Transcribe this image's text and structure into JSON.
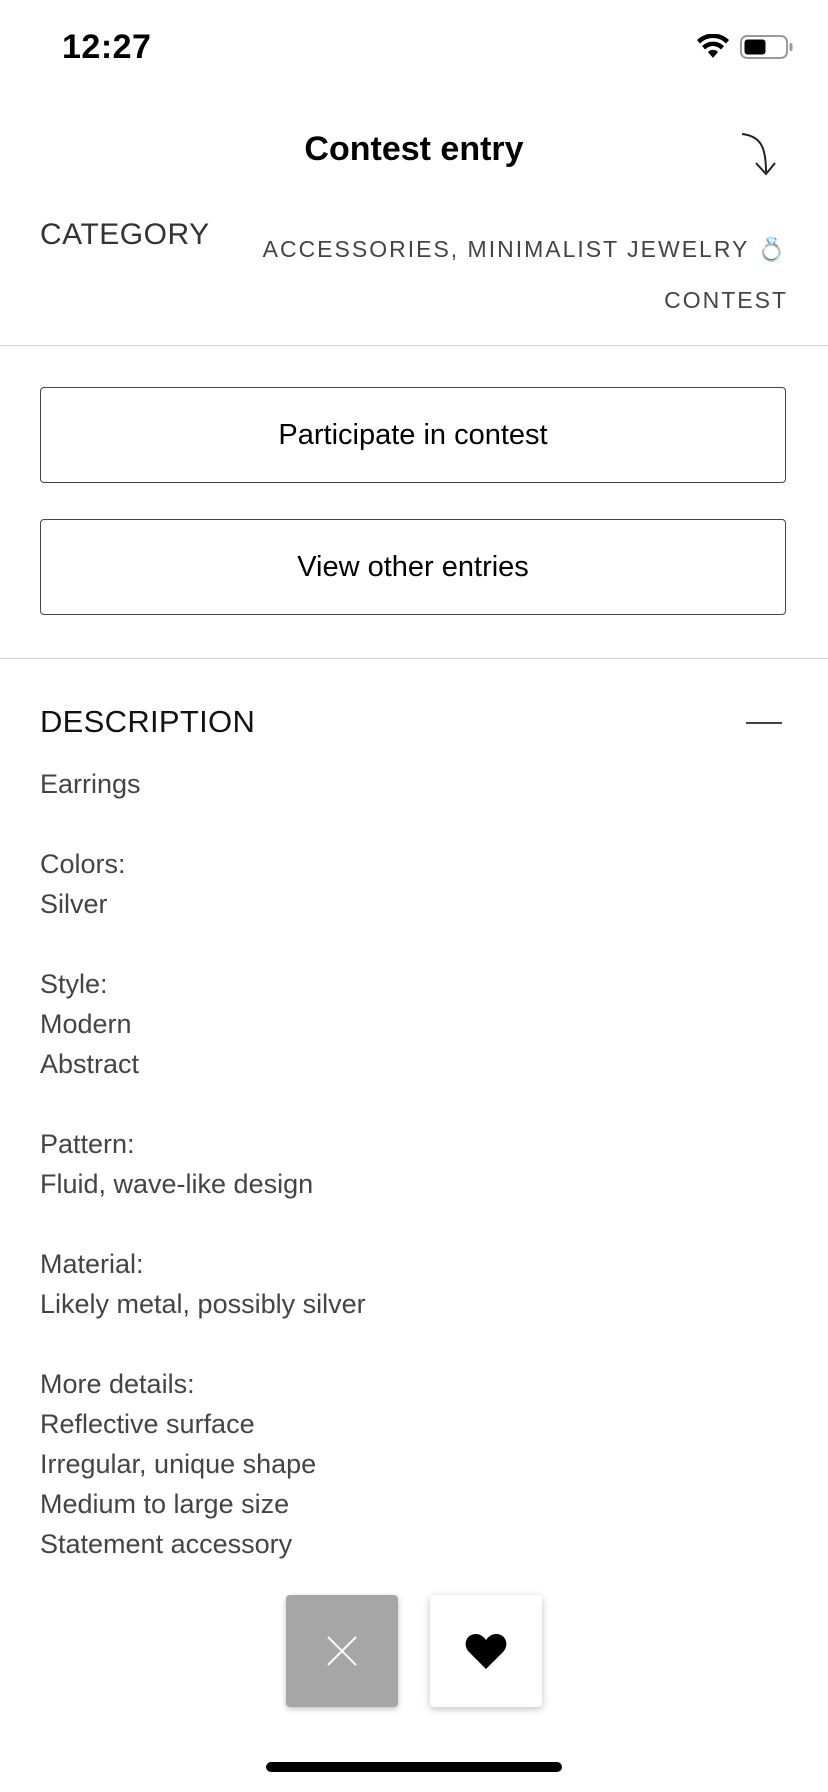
{
  "status_bar": {
    "time": "12:27",
    "icons": [
      "wifi-icon",
      "battery-icon"
    ]
  },
  "nav": {
    "title": "Contest entry",
    "share_icon": "curved-arrow-down-icon"
  },
  "category": {
    "label": "CATEGORY",
    "value_line1": "ACCESSORIES, MINIMALIST JEWELRY 💍",
    "value_line2": "CONTEST"
  },
  "actions": {
    "participate_label": "Participate in contest",
    "view_entries_label": "View other entries"
  },
  "description": {
    "title": "DESCRIPTION",
    "collapse_icon": "minus-icon",
    "item": "Earrings",
    "colors_label": "Colors:",
    "colors": [
      "Silver"
    ],
    "style_label": "Style:",
    "style": [
      "Modern",
      "Abstract"
    ],
    "pattern_label": "Pattern:",
    "pattern": [
      "Fluid, wave-like design"
    ],
    "material_label": "Material:",
    "material": [
      "Likely metal, possibly silver"
    ],
    "details_label": "More details:",
    "details": [
      "Reflective surface",
      "Irregular, unique shape",
      "Medium to large size",
      "Statement accessory"
    ]
  },
  "bottom_actions": {
    "dismiss_icon": "close-icon",
    "like_icon": "heart-icon",
    "dismiss_color": "#a6a6a6",
    "like_color": "#ffffff"
  }
}
